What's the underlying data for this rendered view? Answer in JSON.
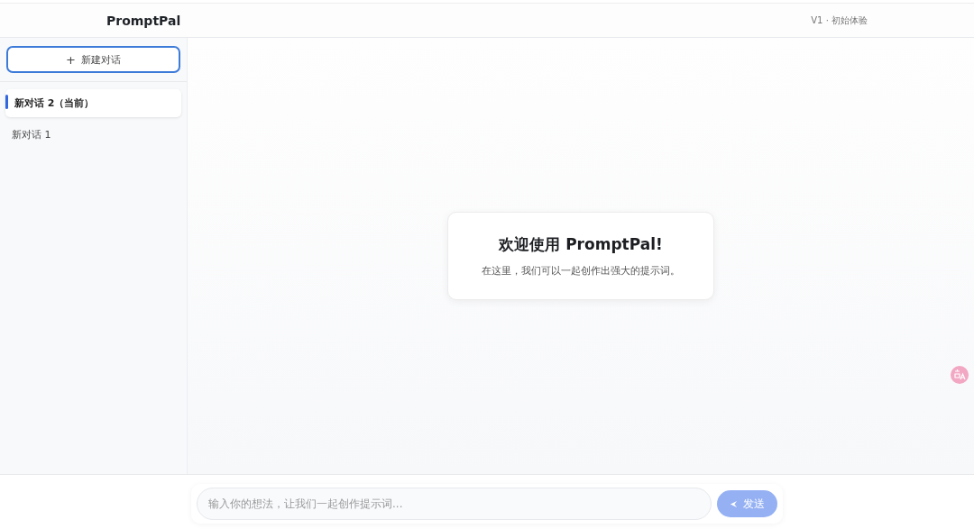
{
  "header": {
    "logo": "PromptPal",
    "version": "V1 · 初始体验"
  },
  "sidebar": {
    "new_button": {
      "icon": "+",
      "label": "新建对话"
    },
    "items": [
      {
        "label": "新对话 2（当前）",
        "selected": true
      },
      {
        "label": "新对话 1",
        "selected": false
      }
    ]
  },
  "welcome": {
    "title": "欢迎使用 PromptPal!",
    "text": "在这里，我们可以一起创作出强大的提示词。"
  },
  "composer": {
    "placeholder": "输入你的想法，让我们一起创作提示词...",
    "send_button": {
      "label": "发送",
      "disabled": true
    }
  }
}
